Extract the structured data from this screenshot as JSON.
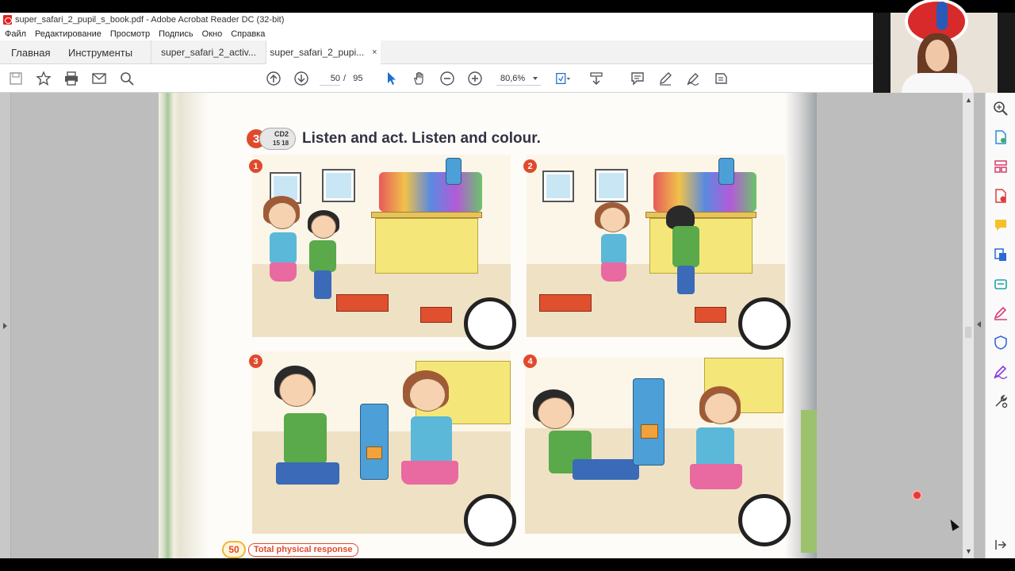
{
  "window": {
    "title": "super_safari_2_pupil_s_book.pdf - Adobe Acrobat Reader DC (32-bit)"
  },
  "menu": [
    "Файл",
    "Редактирование",
    "Просмотр",
    "Подпись",
    "Окно",
    "Справка"
  ],
  "tabs": {
    "home": "Главная",
    "tools": "Инструменты",
    "documents": [
      {
        "label": "super_safari_2_activ...",
        "active": false
      },
      {
        "label": "super_safari_2_pupi...",
        "active": true
      }
    ],
    "close_glyph": "×"
  },
  "toolbar": {
    "current_page": "50",
    "separator": "/",
    "total_pages": "95",
    "zoom": "80,6%"
  },
  "page": {
    "exercise_number": "3",
    "cd_label": "CD2",
    "cd_tracks": "15 18",
    "instruction": "Listen and act. Listen and colour.",
    "pictures": [
      "1",
      "2",
      "3",
      "4"
    ],
    "page_number": "50",
    "footer_label": "Total physical response"
  },
  "colors": {
    "accent_red": "#e04a2c",
    "doc_bg": "#bdbdbd"
  }
}
